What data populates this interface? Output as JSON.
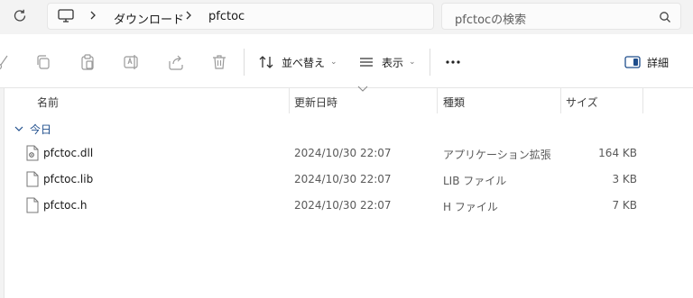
{
  "address_bar": {
    "breadcrumbs": [
      "ダウンロード",
      "pfctoc"
    ]
  },
  "search": {
    "placeholder": "pfctocの検索"
  },
  "toolbar": {
    "sort_label": "並べ替え",
    "view_label": "表示",
    "details_label": "詳細"
  },
  "columns": {
    "name": "名前",
    "modified": "更新日時",
    "type": "種類",
    "size": "サイズ"
  },
  "group": {
    "label": "今日"
  },
  "files": [
    {
      "name": "pfctoc.dll",
      "modified": "2024/10/30 22:07",
      "type": "アプリケーション拡張",
      "size": "164 KB",
      "icon": "dll-file-icon"
    },
    {
      "name": "pfctoc.lib",
      "modified": "2024/10/30 22:07",
      "type": "LIB ファイル",
      "size": "3 KB",
      "icon": "file-icon"
    },
    {
      "name": "pfctoc.h",
      "modified": "2024/10/30 22:07",
      "type": "H ファイル",
      "size": "7 KB",
      "icon": "file-icon"
    }
  ],
  "colors": {
    "accent": "#1f4e8c",
    "toolbar_disabled": "#9a9a9a"
  }
}
